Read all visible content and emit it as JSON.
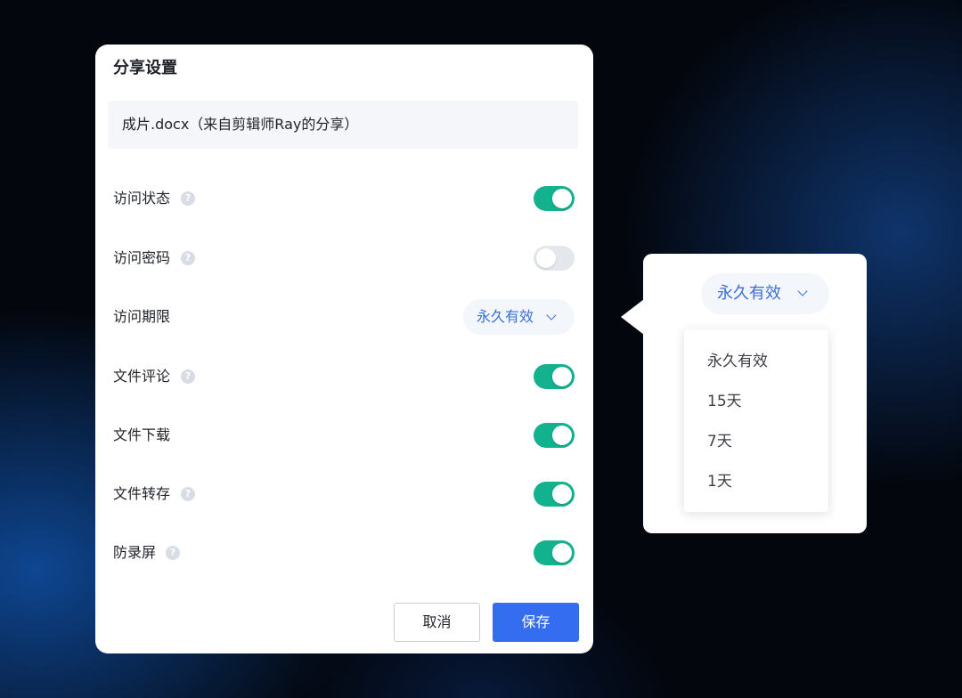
{
  "dialog": {
    "title": "分享设置",
    "file_name": "成片.docx（来自剪辑师Ray的分享）",
    "settings": [
      {
        "label": "访问状态",
        "help_icon": "question-icon",
        "control": "toggle",
        "on": true
      },
      {
        "label": "访问密码",
        "help_icon": "question-icon",
        "control": "toggle",
        "on": false
      },
      {
        "label": "访问期限",
        "control": "select",
        "value": "永久有效",
        "icon": "chevron-down-icon"
      },
      {
        "label": "文件评论",
        "help_icon": "question-icon",
        "control": "toggle",
        "on": true
      },
      {
        "label": "文件下载",
        "control": "toggle",
        "on": true
      },
      {
        "label": "文件转存",
        "help_icon": "question-icon",
        "control": "toggle",
        "on": true
      },
      {
        "label": "防录屏",
        "help_icon": "question-icon",
        "control": "toggle",
        "on": true
      }
    ],
    "buttons": {
      "cancel_label": "取消",
      "save_label": "保存"
    }
  },
  "callout": {
    "select_value": "永久有效",
    "options": [
      "永久有效",
      "15天",
      "7天",
      "1天"
    ]
  },
  "help_icon_glyph": "?",
  "colors": {
    "toggle_on": "#13b28f",
    "toggle_off": "#e4e7ec",
    "accent": "#356df0",
    "select_text": "#3b6fd8"
  }
}
